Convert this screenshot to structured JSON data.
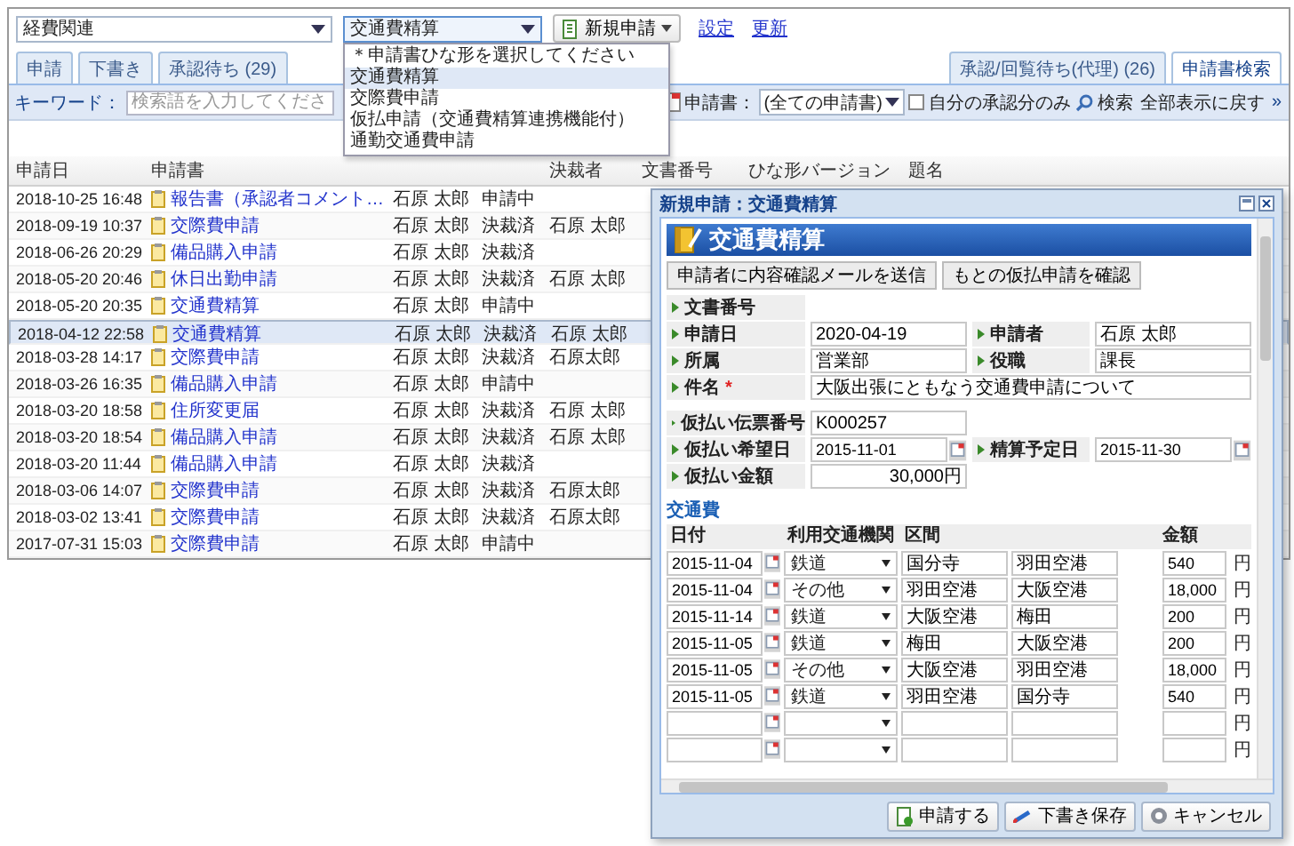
{
  "main_window": {
    "category_select": {
      "value": "経費関連"
    },
    "template_select": {
      "value": "交通費精算",
      "expanded": true,
      "options": [
        {
          "label": "＊申請書ひな形を選択してください",
          "selected": false
        },
        {
          "label": "交通費精算",
          "selected": true
        },
        {
          "label": "交際費申請",
          "selected": false
        },
        {
          "label": "仮払申請（交通費精算連携機能付）",
          "selected": false
        },
        {
          "label": "通勤交通費申請",
          "selected": false
        }
      ]
    },
    "new_button": "新規申請",
    "links": [
      "設定",
      "更新"
    ],
    "tabs": [
      {
        "label": "申請",
        "selected": false
      },
      {
        "label": "下書き",
        "selected": false
      },
      {
        "label": "承認待ち (29)",
        "selected": false
      },
      {
        "label": "承認/回覧待ち(代理) (26)",
        "selected": false
      },
      {
        "label": "申請書検索",
        "selected": true
      }
    ],
    "search_bar": {
      "keyword_label": "キーワード：",
      "keyword_field": {
        "placeholder": "検索語を入力してくださ"
      },
      "form_label": "申請書：",
      "form_select": "(全ての申請書)",
      "own_only": {
        "label": "自分の承認分のみ",
        "checked": false
      },
      "search_button": "検索",
      "reset_link": "全部表示に戻す",
      "more": "»"
    },
    "table": {
      "columns": [
        "申請日",
        "申請書",
        "決裁者",
        "文書番号",
        "ひな形バージョン",
        "題名"
      ],
      "rows": [
        {
          "date": "2018-10-25 16:48",
          "form": "報告書（承認者コメント…",
          "applicant": "石原 太郎",
          "status": "申請中",
          "selected": false
        },
        {
          "date": "2018-09-19 10:37",
          "form": "交際費申請",
          "applicant": "石原 太郎",
          "status": "決裁済",
          "approver": "石原 太郎",
          "selected": false
        },
        {
          "date": "2018-06-26 20:29",
          "form": "備品購入申請",
          "applicant": "石原 太郎",
          "status": "決裁済",
          "selected": false
        },
        {
          "date": "2018-05-20 20:46",
          "form": "休日出勤申請",
          "applicant": "石原 太郎",
          "status": "決裁済",
          "approver": "石原 太郎",
          "selected": false
        },
        {
          "date": "2018-05-20 20:35",
          "form": "交通費精算",
          "applicant": "石原 太郎",
          "status": "申請中",
          "selected": false
        },
        {
          "date": "2018-04-12 22:58",
          "form": "交通費精算",
          "applicant": "石原 太郎",
          "status": "決裁済",
          "approver": "石原 太郎",
          "selected": true
        },
        {
          "date": "2018-03-28 14:17",
          "form": "交際費申請",
          "applicant": "石原 太郎",
          "status": "決裁済",
          "approver": "石原太郎",
          "selected": false
        },
        {
          "date": "2018-03-26 16:35",
          "form": "備品購入申請",
          "applicant": "石原 太郎",
          "status": "申請中",
          "selected": false
        },
        {
          "date": "2018-03-20 18:58",
          "form": "住所変更届",
          "applicant": "石原 太郎",
          "status": "決裁済",
          "approver": "石原 太郎",
          "selected": false
        },
        {
          "date": "2018-03-20 18:54",
          "form": "備品購入申請",
          "applicant": "石原 太郎",
          "status": "決裁済",
          "approver": "石原 太郎",
          "selected": false
        },
        {
          "date": "2018-03-20 11:44",
          "form": "備品購入申請",
          "applicant": "石原 太郎",
          "status": "決裁済",
          "selected": false
        },
        {
          "date": "2018-03-06 14:07",
          "form": "交際費申請",
          "applicant": "石原 太郎",
          "status": "決裁済",
          "approver": "石原太郎",
          "selected": false
        },
        {
          "date": "2018-03-02 13:41",
          "form": "交際費申請",
          "applicant": "石原 太郎",
          "status": "決裁済",
          "approver": "石原太郎",
          "selected": false
        },
        {
          "date": "2017-07-31 15:03",
          "form": "交際費申請",
          "applicant": "石原 太郎",
          "status": "申請中",
          "selected": false
        }
      ]
    }
  },
  "dialog": {
    "title": "新規申請：交通費精算",
    "banner": "交通費精算",
    "actions": [
      "申請者に内容確認メールを送信",
      "もとの仮払申請を確認"
    ],
    "form_sections": [
      {
        "rows": [
          {
            "fields": [
              {
                "label": "文書番号",
                "kind": "none"
              }
            ]
          },
          {
            "fields": [
              {
                "label": "申請日",
                "kind": "text",
                "value": "2020-04-19"
              },
              {
                "label": "申請者",
                "kind": "text",
                "value": "石原 太郎"
              }
            ]
          },
          {
            "fields": [
              {
                "label": "所属",
                "kind": "text",
                "value": "営業部"
              },
              {
                "label": "役職",
                "kind": "text",
                "value": "課長"
              }
            ]
          },
          {
            "fields": [
              {
                "label": "件名",
                "required_mark": "*",
                "kind": "wide",
                "value": "大阪出張にともなう交通費申請について"
              }
            ]
          }
        ]
      },
      {
        "rows": [
          {
            "fields": [
              {
                "label": "仮払い伝票番号",
                "kind": "text",
                "value": "K000257"
              }
            ]
          },
          {
            "fields": [
              {
                "label": "仮払い希望日",
                "kind": "date",
                "value": "2015-11-01"
              },
              {
                "label": "精算予定日",
                "kind": "date",
                "value": "2015-11-30"
              }
            ]
          },
          {
            "fields": [
              {
                "label": "仮払い金額",
                "kind": "amount",
                "value": "30,000円"
              }
            ]
          }
        ]
      }
    ],
    "transport": {
      "heading": "交通費",
      "columns": [
        "日付",
        "利用交通機関",
        "区間",
        "金額"
      ],
      "rows": [
        {
          "date": "2015-11-04",
          "mode": "鉄道",
          "from": "国分寺",
          "to": "羽田空港",
          "amount": "540",
          "unit": "円"
        },
        {
          "date": "2015-11-04",
          "mode": "その他",
          "from": "羽田空港",
          "to": "大阪空港",
          "amount": "18,000",
          "unit": "円"
        },
        {
          "date": "2015-11-14",
          "mode": "鉄道",
          "from": "大阪空港",
          "to": "梅田",
          "amount": "200",
          "unit": "円"
        },
        {
          "date": "2015-11-05",
          "mode": "鉄道",
          "from": "梅田",
          "to": "大阪空港",
          "amount": "200",
          "unit": "円"
        },
        {
          "date": "2015-11-05",
          "mode": "その他",
          "from": "大阪空港",
          "to": "羽田空港",
          "amount": "18,000",
          "unit": "円"
        },
        {
          "date": "2015-11-05",
          "mode": "鉄道",
          "from": "羽田空港",
          "to": "国分寺",
          "amount": "540",
          "unit": "円"
        },
        {
          "unit": "円"
        },
        {
          "unit": "円"
        }
      ]
    },
    "footer_buttons": [
      {
        "label": "申請する",
        "kind": "submit"
      },
      {
        "label": "下書き保存",
        "kind": "draft"
      },
      {
        "label": "キャンセル",
        "kind": "cancel"
      }
    ]
  }
}
